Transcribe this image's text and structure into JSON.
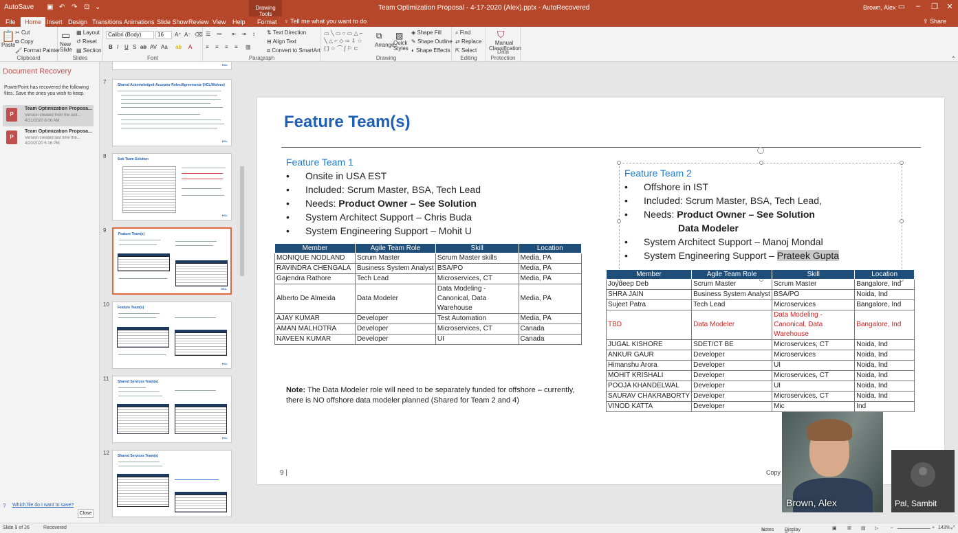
{
  "titlebar": {
    "autosave": "AutoSave",
    "drawing_tools": "Drawing Tools",
    "document_title": "Team Optimization Proposal - 4-17-2020 (Alex).pptx  -  AutoRecovered",
    "user": "Brown, Alex"
  },
  "tabs": [
    "File",
    "Home",
    "Insert",
    "Design",
    "Transitions",
    "Animations",
    "Slide Show",
    "Review",
    "View",
    "Help",
    "Format"
  ],
  "tell_me": "Tell me what you want to do",
  "share": "Share",
  "ribbon": {
    "clipboard": {
      "label": "Clipboard",
      "paste": "Paste",
      "cut": "Cut",
      "copy": "Copy",
      "format_painter": "Format Painter"
    },
    "slides": {
      "label": "Slides",
      "new_slide": "New Slide",
      "layout": "Layout",
      "reset": "Reset",
      "section": "Section"
    },
    "font": {
      "label": "Font",
      "font_name": "Calibri (Body)",
      "font_size": "16"
    },
    "paragraph": {
      "label": "Paragraph",
      "text_direction": "Text Direction",
      "align_text": "Align Text",
      "smartart": "Convert to SmartArt"
    },
    "drawing": {
      "label": "Drawing",
      "arrange": "Arrange",
      "quick_styles": "Quick Styles",
      "shape_fill": "Shape Fill",
      "shape_outline": "Shape Outline",
      "shape_effects": "Shape Effects"
    },
    "editing": {
      "label": "Editing",
      "find": "Find",
      "replace": "Replace",
      "select": "Select"
    },
    "data_protection": {
      "label": "Data Protection",
      "manual": "Manual Classification"
    }
  },
  "recovery": {
    "title": "Document Recovery",
    "message": "PowerPoint has recovered the following files.  Save the ones you wish to keep.",
    "files": [
      {
        "name": "Team Optimization Proposa...",
        "desc": "Version created from the last...",
        "date": "4/21/2020 8:06 AM"
      },
      {
        "name": "Team Optimization Proposa...",
        "desc": "Version created last time the...",
        "date": "4/20/2020 5:16 PM"
      }
    ],
    "which_file": "Which file do I want to save?",
    "close": "Close"
  },
  "thumbnails": [
    {
      "num": "7",
      "title": "Shared Acknowledged-Acceptor Roles/Agreements (HCL/Wolves)"
    },
    {
      "num": "8",
      "title": "Sub Team Solution"
    },
    {
      "num": "9",
      "title": "Feature Team(s)"
    },
    {
      "num": "10",
      "title": "Feature Team(s)"
    },
    {
      "num": "11",
      "title": "Shared Services Team(s)"
    },
    {
      "num": "12",
      "title": "Shared Services Team(s)"
    }
  ],
  "slide": {
    "title": "Feature Team(s)",
    "team1": {
      "heading": "Feature Team 1",
      "b1": "Onsite in USA EST",
      "b2": "Included: Scrum Master, BSA, Tech Lead",
      "b3_pre": "Needs: ",
      "b3_bold": "Product Owner – See Solution",
      "b4": "System Architect Support – Chris Buda",
      "b5": "System Engineering Support – Mohit U",
      "headers": [
        "Member",
        "Agile Team Role",
        "Skill",
        "Location"
      ],
      "rows": [
        [
          "MONIQUE NODLAND",
          "Scrum Master",
          "Scrum Master skills",
          "Media, PA"
        ],
        [
          "RAVINDRA CHENGALA",
          "Business System Analyst",
          "BSA/PO",
          "Media, PA"
        ],
        [
          "Gajendra Rathore",
          "Tech Lead",
          "Microservices, CT",
          "Media, PA"
        ],
        [
          "Alberto De Almeida",
          "Data Modeler",
          "Data Modeling - Canonical, Data Warehouse",
          "Media, PA"
        ],
        [
          "AJAY KUMAR",
          "Developer",
          "Test Automation",
          "Media, PA"
        ],
        [
          "AMAN MALHOTRA",
          "Developer",
          "Microservices, CT",
          "Canada"
        ],
        [
          "NAVEEN KUMAR",
          "Developer",
          "UI",
          "Canada"
        ]
      ]
    },
    "team2": {
      "heading": "Feature Team 2",
      "b1": "Offshore in IST",
      "b2": "Included: Scrum Master, BSA, Tech Lead,",
      "b3_pre": "Needs: ",
      "b3_bold": "Product Owner – See Solution",
      "b3_cont": "Data Modeler",
      "b4": "System Architect Support – Manoj Mondal",
      "b5_pre": "System Engineering Support – ",
      "b5_hl": "Prateek Gupta",
      "headers": [
        "Member",
        "Agile Team Role",
        "Skill",
        "Location"
      ],
      "rows": [
        [
          "Joydeep Deb",
          "Scrum Master",
          "Scrum Master",
          "Bangalore, Ind"
        ],
        [
          "SHRA JAIN",
          "Business System Analyst",
          "BSA/PO",
          "Noida, Ind"
        ],
        [
          "Sujeet Patra",
          "Tech Lead",
          "Microservices",
          "Bangalore, Ind"
        ],
        [
          "TBD",
          "Data Modeler",
          "Data Modeling - Canonical, Data Warehouse",
          "Bangalore, Ind"
        ],
        [
          "JUGAL KISHORE",
          "SDET/CT BE",
          "Microservices, CT",
          "Noida, Ind"
        ],
        [
          "ANKUR GAUR",
          "Developer",
          "Microservices",
          "Noida, Ind"
        ],
        [
          "Himanshu Arora",
          "Developer",
          "UI",
          "Noida, Ind"
        ],
        [
          "MOHIT KRISHALI",
          "Developer",
          "Microservices, CT",
          "Noida, Ind"
        ],
        [
          "POOJA KHANDELWAL",
          "Developer",
          "UI",
          "Noida, Ind"
        ],
        [
          "SAURAV CHAKRABORTY",
          "Developer",
          "Microservices, CT",
          "Noida, Ind"
        ],
        [
          "VINOD KATTA",
          "Developer",
          "Mic",
          "Ind"
        ]
      ]
    },
    "note_label": "Note:",
    "note_text": "  The Data Modeler role will need to be separately funded for offshore – currently, there is NO offshore data modeler planned (Shared for Team 2 and 4)",
    "page_number": "9  |",
    "copyright": "Copy"
  },
  "video": {
    "alex": "Brown, Alex",
    "pal": "Pal, Sambit"
  },
  "status": {
    "slide": "Slide 9 of 26",
    "recovered": "Recovered",
    "notes": "Notes",
    "display": "Display Settings",
    "zoom": "143%"
  }
}
